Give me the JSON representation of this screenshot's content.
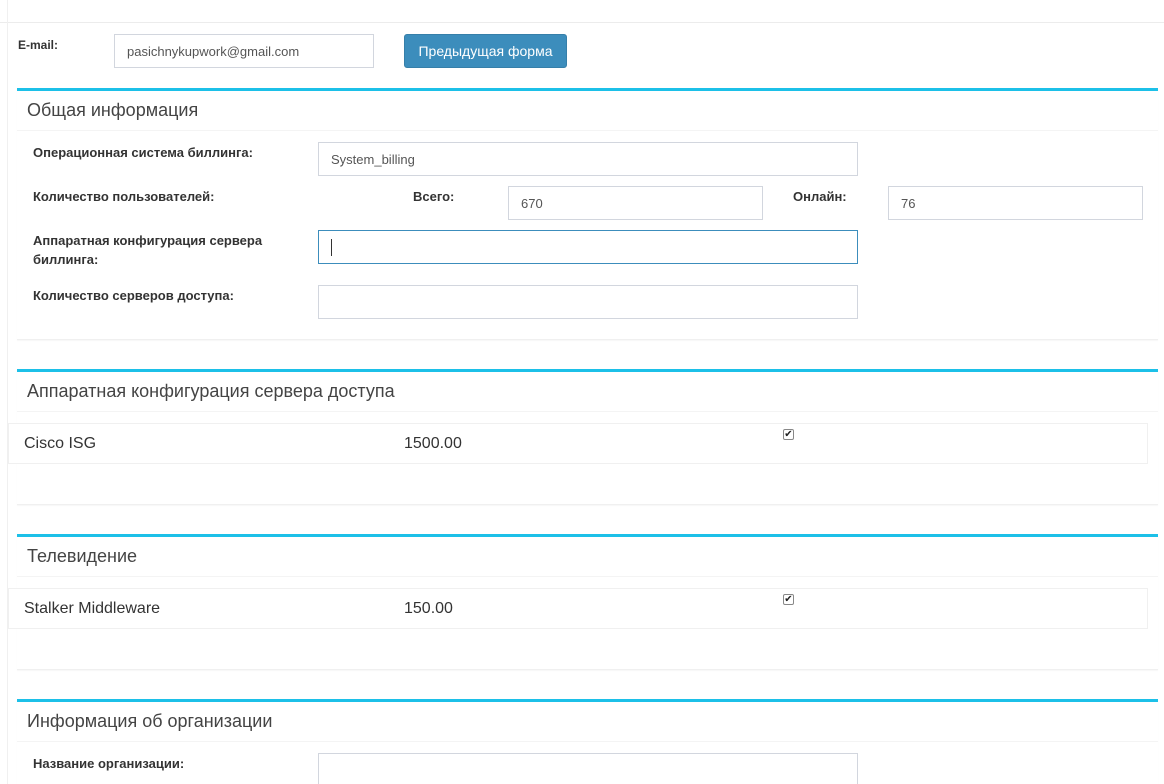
{
  "top": {
    "email_label": "E-mail:",
    "email_value": "pasichnykupwork@gmail.com",
    "prev_button": "Предыдущая форма"
  },
  "general": {
    "title": "Общая информация",
    "os_label": "Операционная система биллинга:",
    "os_value": "System_billing",
    "users_label": "Количество пользователей:",
    "total_label": "Всего:",
    "total_value": "670",
    "online_label": "Онлайн:",
    "online_value": "76",
    "hw_label_line1": "Аппаратная конфигурация сервера",
    "hw_label_line2": "биллинга:",
    "hw_value": "",
    "servers_label": "Количество серверов доступа:",
    "servers_value": ""
  },
  "access_hw": {
    "title": "Аппаратная конфигурация сервера доступа",
    "items": [
      {
        "name": "Cisco ISG",
        "price": "1500.00",
        "checked": true
      }
    ]
  },
  "tv": {
    "title": "Телевидение",
    "items": [
      {
        "name": "Stalker Middleware",
        "price": "150.00",
        "checked": true
      }
    ]
  },
  "org": {
    "title": "Информация об организации",
    "name_label": "Название организации:",
    "name_value": ""
  },
  "colors": {
    "accent": "#1cc0e8",
    "button": "#3c8dbc"
  },
  "icons": {
    "checkbox_checked": "check-icon"
  }
}
